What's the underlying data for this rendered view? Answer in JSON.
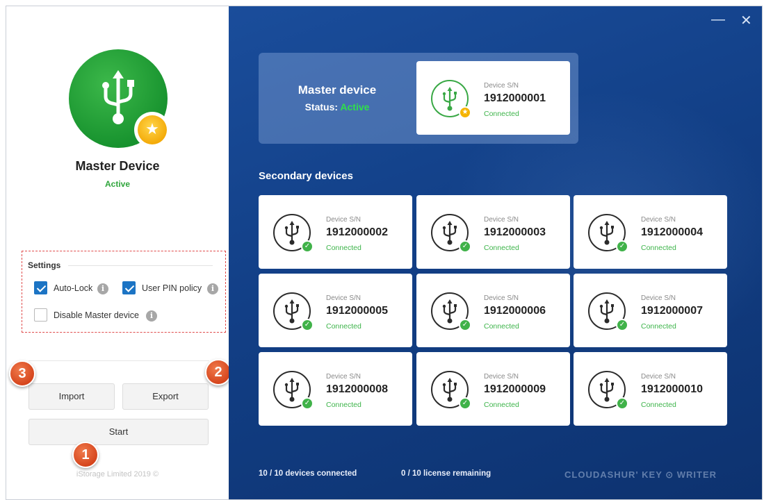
{
  "left": {
    "device_title": "Master Device",
    "device_status": "Active",
    "settings": {
      "heading": "Settings",
      "auto_lock": {
        "label": "Auto-Lock",
        "checked": true
      },
      "user_pin_policy": {
        "label": "User PIN policy",
        "checked": true
      },
      "disable_master": {
        "label": "Disable Master device",
        "checked": false
      }
    },
    "buttons": {
      "import": "Import",
      "export": "Export",
      "start": "Start"
    },
    "copyright": "iStorage Limited 2019 ©",
    "markers": {
      "one": "1",
      "two": "2",
      "three": "3"
    }
  },
  "window_controls": {
    "minimize": "—",
    "close": "✕"
  },
  "master": {
    "label": "Master device",
    "status_prefix": "Status:",
    "status_value": "Active",
    "card": {
      "sn_label": "Device S/N",
      "sn": "1912000001",
      "status": "Connected"
    }
  },
  "secondary": {
    "title": "Secondary devices",
    "devices": [
      {
        "sn_label": "Device S/N",
        "sn": "1912000002",
        "status": "Connected"
      },
      {
        "sn_label": "Device S/N",
        "sn": "1912000003",
        "status": "Connected"
      },
      {
        "sn_label": "Device S/N",
        "sn": "1912000004",
        "status": "Connected"
      },
      {
        "sn_label": "Device S/N",
        "sn": "1912000005",
        "status": "Connected"
      },
      {
        "sn_label": "Device S/N",
        "sn": "1912000006",
        "status": "Connected"
      },
      {
        "sn_label": "Device S/N",
        "sn": "1912000007",
        "status": "Connected"
      },
      {
        "sn_label": "Device S/N",
        "sn": "1912000008",
        "status": "Connected"
      },
      {
        "sn_label": "Device S/N",
        "sn": "1912000009",
        "status": "Connected"
      },
      {
        "sn_label": "Device S/N",
        "sn": "1912000010",
        "status": "Connected"
      }
    ]
  },
  "footer": {
    "devices_connected": "10 / 10 devices connected",
    "license": "0 / 10 license remaining",
    "brand": "CLOUDASHUR' KEY ⊙ WRITER"
  },
  "colors": {
    "accent_green": "#2fa53c",
    "panel_blue": "#123f86",
    "checkbox_blue": "#1c74c4",
    "marker_orange": "#d4421a"
  }
}
